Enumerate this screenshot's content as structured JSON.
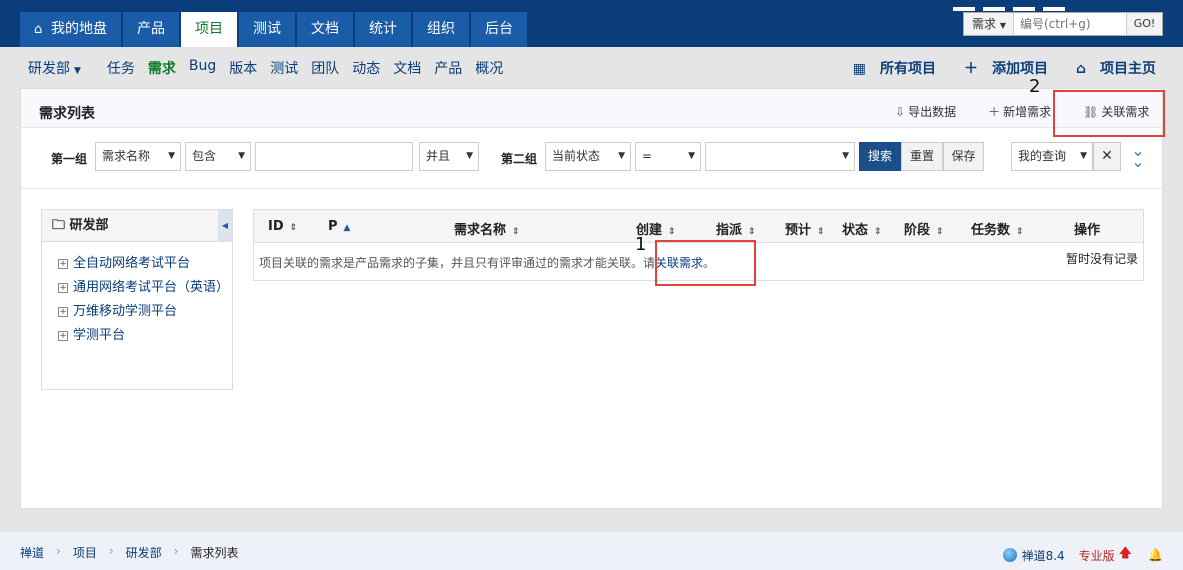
{
  "topnav": {
    "tabs": [
      {
        "label": "我的地盘",
        "icon": "home-icon"
      },
      {
        "label": "产品"
      },
      {
        "label": "项目"
      },
      {
        "label": "测试"
      },
      {
        "label": "文档"
      },
      {
        "label": "统计"
      },
      {
        "label": "组织"
      },
      {
        "label": "后台"
      }
    ],
    "active_index": 2,
    "search": {
      "type_label": "需求",
      "placeholder": "编号(ctrl+g)",
      "go_label": "GO!"
    }
  },
  "subnav": {
    "dept_label": "研发部",
    "items": [
      "任务",
      "需求",
      "Bug",
      "版本",
      "测试",
      "团队",
      "动态",
      "文档",
      "产品",
      "概况"
    ],
    "active_index": 1,
    "right": {
      "all_projects": "所有项目",
      "add_project": "添加项目",
      "project_home": "项目主页"
    }
  },
  "panel": {
    "title": "需求列表",
    "actions": {
      "export": "导出数据",
      "new_story": "新增需求",
      "link_story": "关联需求"
    }
  },
  "filter": {
    "group1_label": "第一组",
    "group1_field": "需求名称",
    "group1_op": "包含",
    "group1_value": "",
    "andor": "并且",
    "group2_label": "第二组",
    "group2_field": "当前状态",
    "group2_op": "=",
    "group2_value": "",
    "search_btn": "搜索",
    "reset_btn": "重置",
    "save_btn": "保存",
    "my_query": "我的查询",
    "clear_label": "✕"
  },
  "tree": {
    "title": "研发部",
    "items": [
      "全自动网络考试平台",
      "通用网络考试平台（英语）",
      "万维移动学测平台",
      "学测平台"
    ]
  },
  "table": {
    "columns": [
      "ID",
      "P",
      "需求名称",
      "创建",
      "指派",
      "预计",
      "状态",
      "阶段",
      "任务数",
      "操作"
    ],
    "empty_prefix": "项目关联的需求是产品需求的子集，并且只有评审通过的需求才能关联。请",
    "empty_link": "关联需求",
    "empty_suffix": "。",
    "no_record": "暂时没有记录"
  },
  "annotations": {
    "one": "1",
    "two": "2"
  },
  "footer": {
    "crumbs": [
      "禅道",
      "项目",
      "研发部",
      "需求列表"
    ],
    "version": "禅道8.4",
    "edition": "专业版"
  },
  "colors": {
    "nav_bg": "#0a3d7a",
    "tab_bg": "#1b5ca8",
    "active_green": "#0f7a2a",
    "annotation_red": "#e0433a",
    "primary_btn": "#1b4f8a"
  }
}
